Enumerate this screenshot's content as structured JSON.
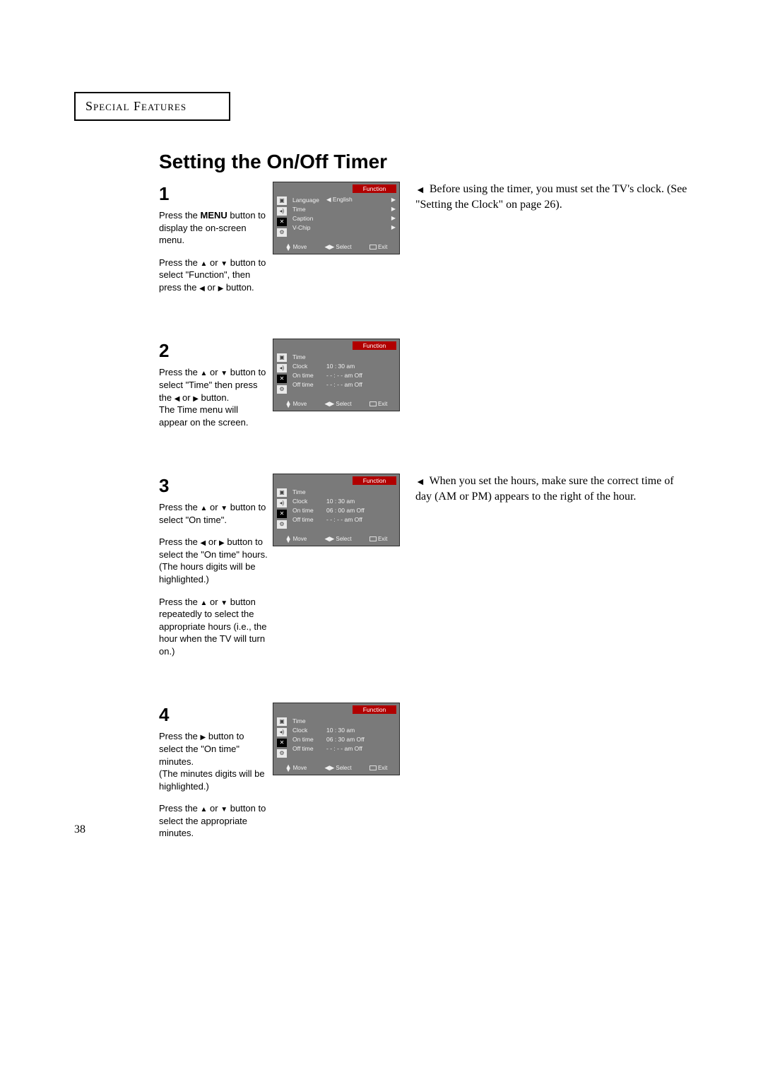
{
  "header": {
    "section": "Special Features"
  },
  "title": "Setting the On/Off Timer",
  "notes": {
    "n1": "Before using the timer, you must set the TV's clock. (See \"Setting the Clock\" on page 26).",
    "n3": "When you set the hours, make sure the correct time of day (AM or PM) appears to the right of the hour."
  },
  "steps": [
    {
      "num": "1",
      "paras": [
        "Press the <b>MENU</b> button to display the on-screen menu.",
        "Press the ▲ or ▼ button to select \"Function\", then press the ◀ or ▶ button."
      ],
      "osd": {
        "title": "Function",
        "icons": [
          "tv",
          "snd",
          "set",
          "sli"
        ],
        "active_icon": 2,
        "rows": [
          {
            "label": "Language",
            "value": "◀  English",
            "arrow": "▶"
          },
          {
            "label": "Time",
            "value": "",
            "arrow": "▶"
          },
          {
            "label": "Caption",
            "value": "",
            "arrow": "▶"
          },
          {
            "label": "V-Chip",
            "value": "",
            "arrow": "▶"
          }
        ]
      }
    },
    {
      "num": "2",
      "paras": [
        "Press the ▲ or ▼ button to select \"Time\" then press the ◀ or ▶ button.<br>The Time menu will appear on the screen."
      ],
      "osd": {
        "title": "Function",
        "icons": [
          "tv",
          "snd",
          "set",
          "sli"
        ],
        "active_icon": 2,
        "rows": [
          {
            "label": "Time",
            "value": "",
            "arrow": ""
          },
          {
            "label": "Clock",
            "value": "10 : 30 am",
            "arrow": ""
          },
          {
            "label": "On time",
            "value": "- -  :  - - am   Off",
            "arrow": ""
          },
          {
            "label": "Off time",
            "value": "- -  :  - - am   Off",
            "arrow": ""
          }
        ]
      }
    },
    {
      "num": "3",
      "paras": [
        "Press the ▲ or ▼ button to select \"On time\".",
        "Press the ◀ or ▶ button to select the \"On time\" hours. (The hours digits will be highlighted.)",
        "Press the ▲ or ▼ button repeatedly to select the appropriate hours (i.e., the hour when the TV will turn on.)"
      ],
      "osd": {
        "title": "Function",
        "icons": [
          "tv",
          "snd",
          "set",
          "sli"
        ],
        "active_icon": 2,
        "rows": [
          {
            "label": "Time",
            "value": "",
            "arrow": ""
          },
          {
            "label": "Clock",
            "value": "10 : 30 am",
            "arrow": ""
          },
          {
            "label": "On time",
            "value": "06 : 00 am   Off",
            "arrow": ""
          },
          {
            "label": "Off time",
            "value": "- -  :  - - am   Off",
            "arrow": ""
          }
        ]
      }
    },
    {
      "num": "4",
      "paras": [
        "Press the ▶ button to select the \"On time\" minutes.<br>(The minutes digits will be highlighted.)",
        "Press the ▲ or ▼ button to select the appropriate minutes."
      ],
      "osd": {
        "title": "Function",
        "icons": [
          "tv",
          "snd",
          "set",
          "sli"
        ],
        "active_icon": 2,
        "rows": [
          {
            "label": "Time",
            "value": "",
            "arrow": ""
          },
          {
            "label": "Clock",
            "value": "10 : 30 am",
            "arrow": ""
          },
          {
            "label": "On time",
            "value": "06 : 30 am   Off",
            "arrow": ""
          },
          {
            "label": "Off time",
            "value": "- -  :  - - am   Off",
            "arrow": ""
          }
        ]
      }
    }
  ],
  "osd_footer": {
    "move": "Move",
    "select": "Select",
    "exit": "Exit"
  },
  "page_number": "38"
}
